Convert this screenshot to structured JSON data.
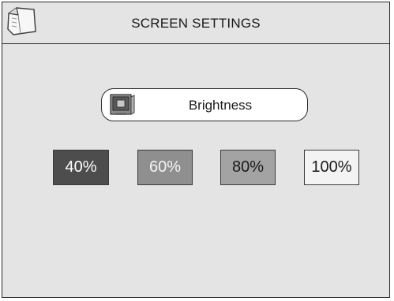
{
  "header": {
    "title": "SCREEN SETTINGS",
    "back_icon": "back-folder-icon"
  },
  "setting": {
    "label": "Brightness",
    "icon": "monitor-icon"
  },
  "brightness_levels": [
    {
      "label": "40%",
      "value": 40,
      "color": "#4d4d4d"
    },
    {
      "label": "60%",
      "value": 60,
      "color": "#8f8f8f"
    },
    {
      "label": "80%",
      "value": 80,
      "color": "#a3a3a3"
    },
    {
      "label": "100%",
      "value": 100,
      "color": "#f3f3f3"
    }
  ],
  "colors": {
    "background": "#e4e4e4",
    "border": "#2a2a2a"
  }
}
